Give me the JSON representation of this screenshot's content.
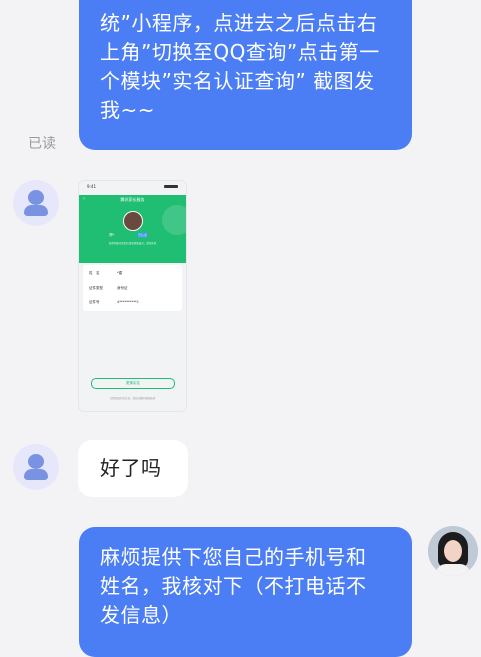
{
  "messages": [
    {
      "id": "m1",
      "from": "me",
      "text": "统”小程序，点进去之后点击右\n上角”切换至QQ查询”点击第一\n个模块”实名认证查询” 截图发\n我~~"
    },
    {
      "id": "m2",
      "from": "other",
      "type": "image"
    },
    {
      "id": "m3",
      "from": "other",
      "text": "好了吗"
    },
    {
      "id": "m4",
      "from": "me",
      "text": "麻烦提供下您自己的手机号和\n姓名，我核对下（不打电话不\n发信息）"
    }
  ],
  "read_status": "已读",
  "screenshot": {
    "status_time": "9:41",
    "title": "腾讯家长服务",
    "name": "郑*",
    "badge": "已认证",
    "hint": "仅用于账号实名信息查询及核对，请勿外泄",
    "rows": [
      {
        "label": "姓　名",
        "value": "*建"
      },
      {
        "label": "证件类型",
        "value": "身份证"
      },
      {
        "label": "证件号",
        "value": "4**********1"
      }
    ],
    "button": "更换实名",
    "footer": "如需修改实名信息，请前往腾讯客服处理"
  },
  "colors": {
    "bubble_me": "#4b7ef5",
    "bubble_other": "#ffffff",
    "background": "#f3f3f5",
    "accent_green": "#1fbe73"
  }
}
